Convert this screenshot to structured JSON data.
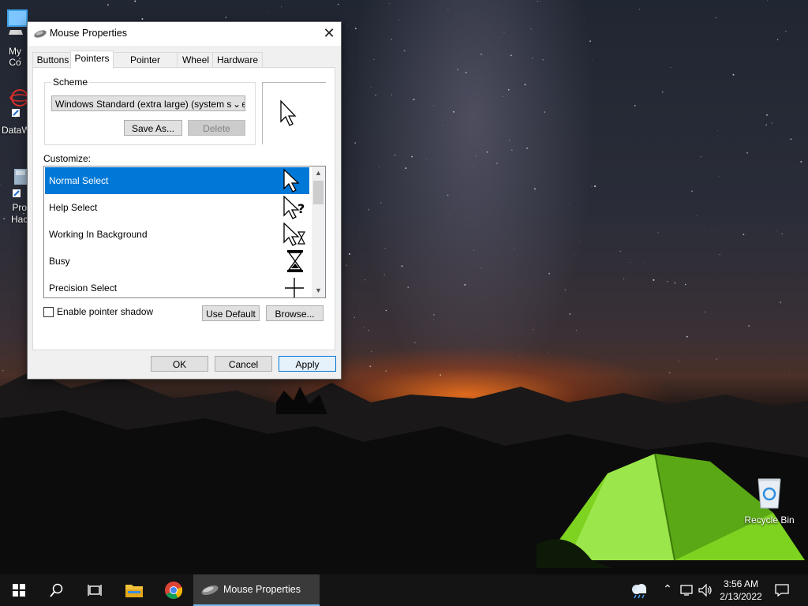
{
  "desktop": {
    "icons": [
      {
        "label": "My Co"
      },
      {
        "label": "DataW"
      },
      {
        "label": "Pro\nHac"
      },
      {
        "label": "Recycle Bin"
      }
    ]
  },
  "window": {
    "title": "Mouse Properties",
    "close_glyph": "✕",
    "tabs": [
      {
        "label": "Buttons"
      },
      {
        "label": "Pointers"
      },
      {
        "label": "Pointer Options"
      },
      {
        "label": "Wheel"
      },
      {
        "label": "Hardware"
      }
    ],
    "active_tab": "Pointers",
    "scheme": {
      "legend": "Scheme",
      "selected": "Windows Standard (extra large) (system scheme)",
      "save_as_label": "Save As...",
      "delete_label": "Delete"
    },
    "customize": {
      "label": "Customize:",
      "items": [
        {
          "label": "Normal Select",
          "icon": "arrow-cursor-icon",
          "selected": true
        },
        {
          "label": "Help Select",
          "icon": "help-cursor-icon",
          "selected": false
        },
        {
          "label": "Working In Background",
          "icon": "working-cursor-icon",
          "selected": false
        },
        {
          "label": "Busy",
          "icon": "hourglass-icon",
          "selected": false
        },
        {
          "label": "Precision Select",
          "icon": "crosshair-icon",
          "selected": false
        }
      ]
    },
    "pointer_shadow": {
      "label": "Enable pointer shadow",
      "checked": false
    },
    "use_default_label": "Use Default",
    "browse_label": "Browse...",
    "ok_label": "OK",
    "cancel_label": "Cancel",
    "apply_label": "Apply"
  },
  "taskbar": {
    "active_app_label": "Mouse Properties",
    "time": "3:56 AM",
    "date": "2/13/2022"
  },
  "colors": {
    "selection": "#0078d7",
    "taskbar": "#141414",
    "tent_green": "#7ed321"
  }
}
